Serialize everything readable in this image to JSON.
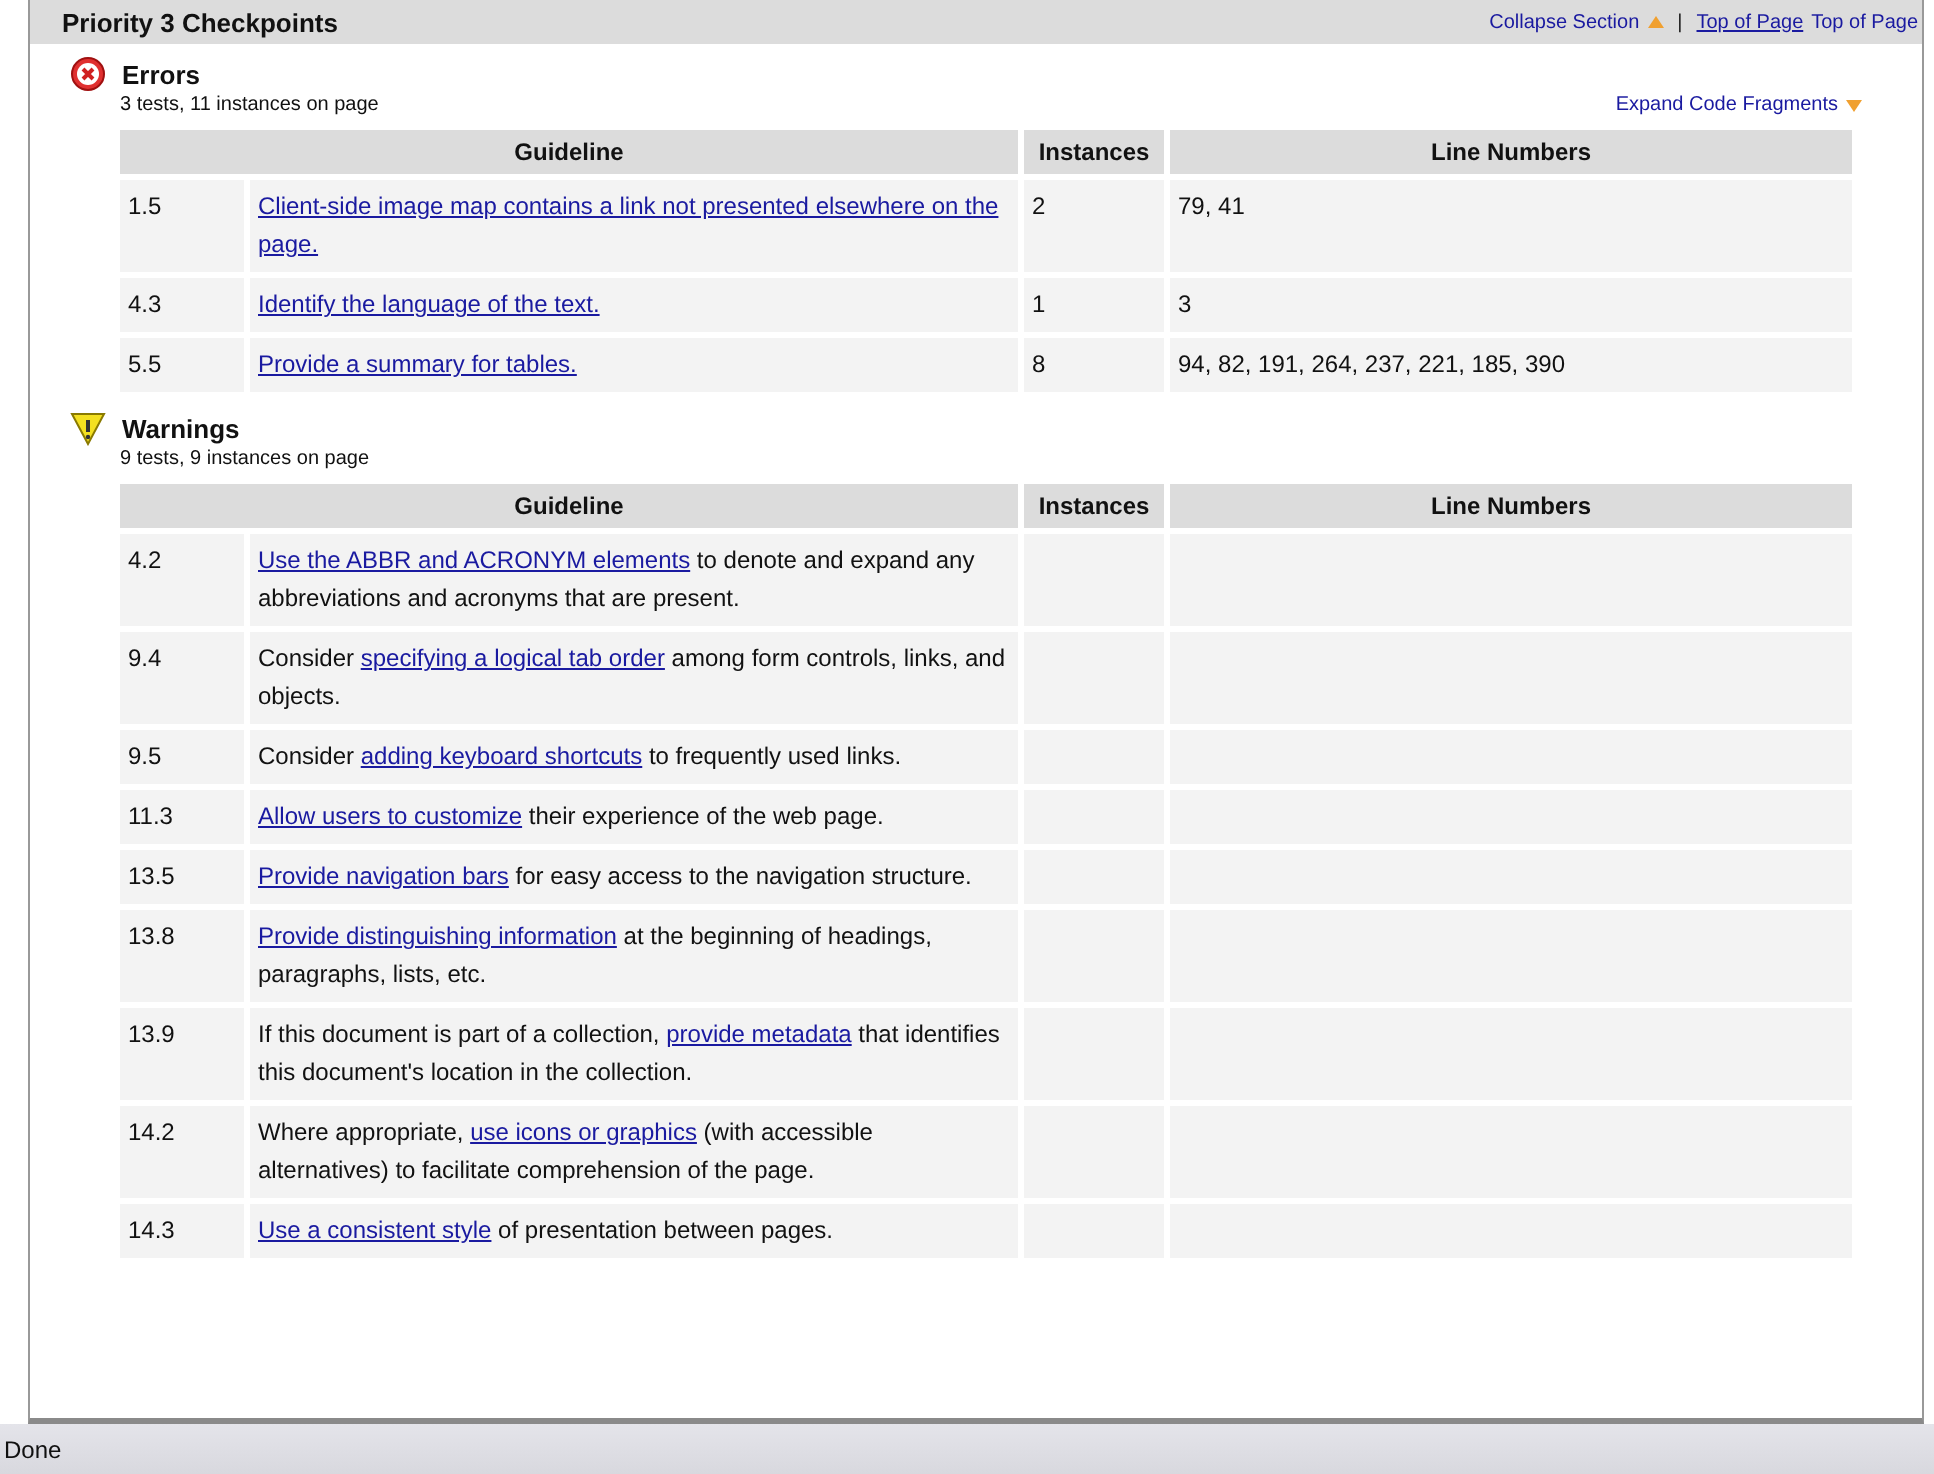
{
  "section": {
    "title": "Priority 3 Checkpoints",
    "collapse_link": "Collapse Section",
    "separator": "|",
    "top_link": "Top of Page",
    "top_text": "Top of Page"
  },
  "groups": [
    {
      "kind": "error",
      "title": "Errors",
      "summary": "3 tests, 11 instances on page",
      "expand_link": "Expand Code Fragments",
      "columns": [
        "Guideline",
        "Instances",
        "Line Numbers"
      ],
      "rows": [
        {
          "number": "1.5",
          "link": "Client-side image map contains a link not presented elsewhere on the page.",
          "instances": "2",
          "lines": "79, 41"
        },
        {
          "number": "4.3",
          "link": "Identify the language of the text.",
          "instances": "1",
          "lines": "3"
        },
        {
          "number": "5.5",
          "link": "Provide a summary for tables.",
          "instances": "8",
          "lines": "94, 82, 191, 264, 237, 221, 185, 390"
        }
      ]
    },
    {
      "kind": "warning",
      "title": "Warnings",
      "summary": "9 tests, 9 instances on page",
      "columns": [
        "Guideline",
        "Instances",
        "Line Numbers"
      ],
      "rows": [
        {
          "number": "4.2",
          "link": "Use the ABBR and ACRONYM elements",
          "after": " to denote and expand any abbreviations and acronyms that are present."
        },
        {
          "number": "9.4",
          "before": "Consider ",
          "link": "specifying a logical tab order",
          "after": " among form controls, links, and objects."
        },
        {
          "number": "9.5",
          "before": "Consider ",
          "link": "adding keyboard shortcuts",
          "after": " to frequently used links."
        },
        {
          "number": "11.3",
          "link": "Allow users to customize",
          "after": " their experience of the web page."
        },
        {
          "number": "13.5",
          "link": "Provide navigation bars",
          "after": " for easy access to the navigation structure."
        },
        {
          "number": "13.8",
          "link": "Provide distinguishing information",
          "after": " at the beginning of headings, paragraphs, lists, etc."
        },
        {
          "number": "13.9",
          "before": "If this document is part of a collection, ",
          "link": "provide metadata",
          "after": " that identifies this document's location in the collection."
        },
        {
          "number": "14.2",
          "before": "Where appropriate, ",
          "link": "use icons or graphics",
          "after": " (with accessible alternatives) to facilitate comprehension of the page."
        },
        {
          "number": "14.3",
          "link": "Use a consistent style",
          "after": " of presentation between pages."
        }
      ]
    }
  ],
  "status_bar": {
    "text": "Done"
  }
}
